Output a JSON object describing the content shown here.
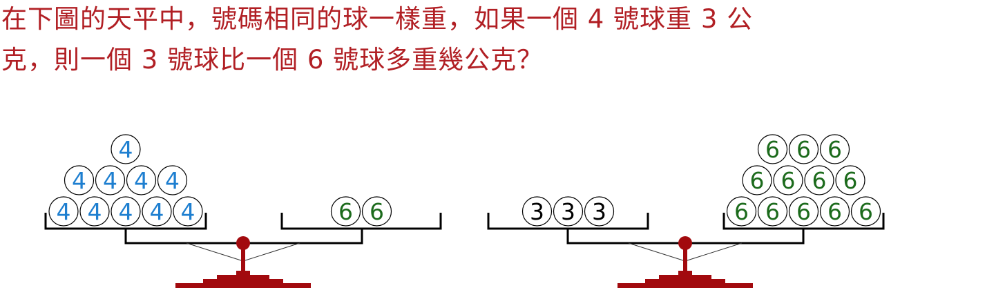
{
  "question": {
    "line1": "在下圖的天平中，號碼相同的球一樣重，如果一個 4 號球重 3 公",
    "line2": "克，則一個 3 號球比一個 6 號球多重幾公克？"
  },
  "colors": {
    "text": "#b11f24",
    "scale": "#a20a0e",
    "frame": "#000000",
    "ball_4": "#1e7fd0",
    "ball_6": "#1c6b1c",
    "ball_3": "#000000"
  },
  "balances": [
    {
      "name": "balance-left",
      "left_pan": {
        "ball_label": "4",
        "rows": [
          1,
          4,
          5
        ]
      },
      "right_pan": {
        "ball_label": "6",
        "rows": [
          2
        ]
      }
    },
    {
      "name": "balance-right",
      "left_pan": {
        "ball_label": "3",
        "rows": [
          3
        ]
      },
      "right_pan": {
        "ball_label": "6",
        "rows": [
          3,
          4,
          5
        ]
      }
    }
  ]
}
